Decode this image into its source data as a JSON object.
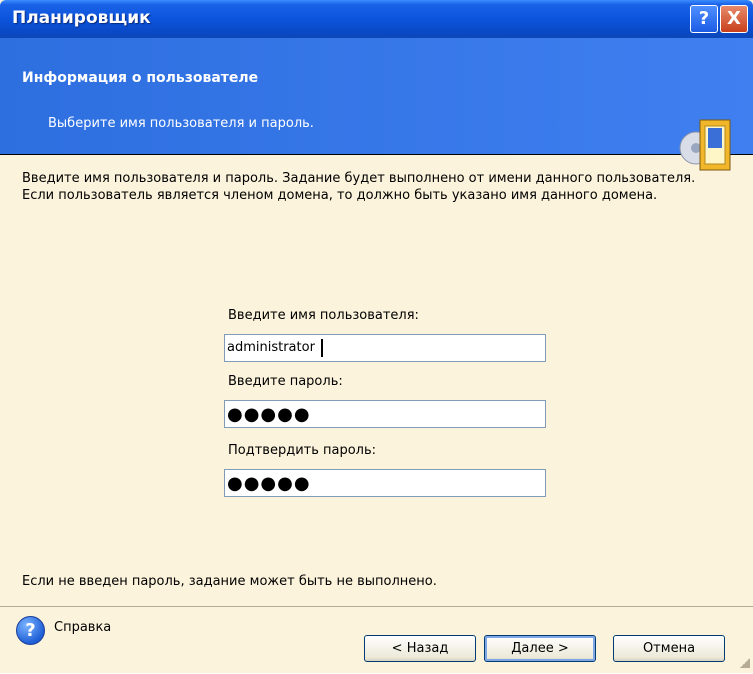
{
  "window": {
    "title": "Планировщик",
    "help_glyph": "?",
    "close_glyph": "X"
  },
  "header": {
    "title": "Информация о пользователе",
    "subtitle": "Выберите имя пользователя и пароль.",
    "icon": "scheduler-wizard-icon"
  },
  "intro": "Введите имя пользователя и пароль. Задание будет выполнено от имени данного пользователя. Если пользователь является членом домена, то должно быть указано имя данного домена.",
  "form": {
    "username_label": "Введите имя пользователя:",
    "username_value": "administrator",
    "password_label": "Введите пароль:",
    "password_value": "●●●●●",
    "confirm_label": "Подтвердить пароль:",
    "confirm_value": "●●●●●"
  },
  "note": "Если не введен пароль, задание может быть не выполнено.",
  "footer": {
    "help_label": "Справка",
    "back_label": "< Назад",
    "next_label": "Далее >",
    "cancel_label": "Отмена"
  },
  "colors": {
    "titlebar": "#0A49C6",
    "header": "#3A78E8",
    "body": "#FBF3DB"
  }
}
